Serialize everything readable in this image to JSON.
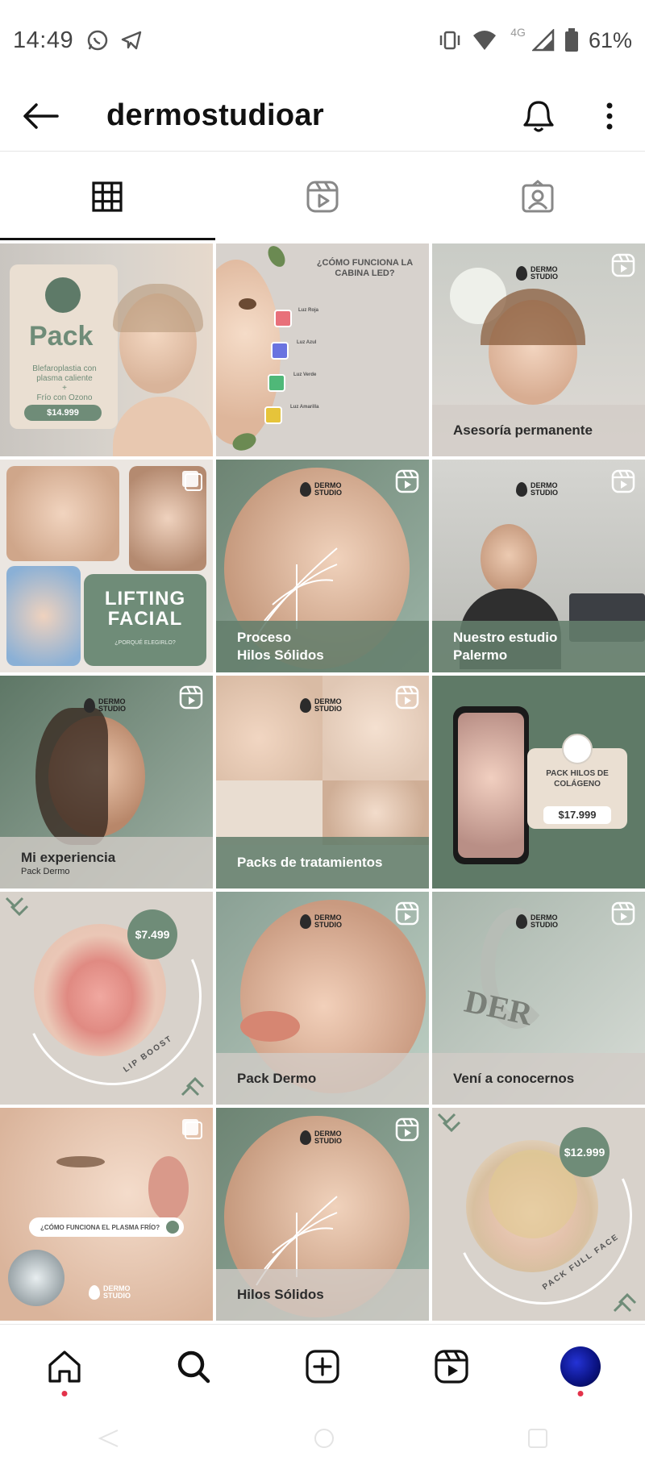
{
  "status_bar": {
    "time": "14:49",
    "battery": "61%",
    "network": "4G"
  },
  "header": {
    "username": "dermostudioar"
  },
  "tabs": [
    {
      "name": "posts-grid",
      "active": true
    },
    {
      "name": "reels",
      "active": false
    },
    {
      "name": "tagged",
      "active": false
    }
  ],
  "posts": [
    {
      "type": "image",
      "texts": {
        "title": "Pack",
        "desc1": "Blefaroplastia con",
        "desc2": "plasma caliente",
        "desc3": "+",
        "desc4": "Frío con Ozono",
        "price": "$14.999"
      }
    },
    {
      "type": "image",
      "texts": {
        "title1": "¿CÓMO FUNCIONA LA",
        "title2": "CABINA LED?",
        "l1": "Luz Roja",
        "l2": "Luz Azul",
        "l3": "Luz Verde",
        "l4": "Luz Amarilla"
      }
    },
    {
      "type": "reel",
      "caption": "Asesoría permanente"
    },
    {
      "type": "carousel",
      "texts": {
        "title1": "LIFTING",
        "title2": "FACIAL",
        "sub": "¿PORQUÉ ELEGIRLO?"
      }
    },
    {
      "type": "reel",
      "caption": "Proceso",
      "caption2": "Hilos Sólidos"
    },
    {
      "type": "reel",
      "caption": "Nuestro estudio",
      "caption2": "Palermo"
    },
    {
      "type": "reel",
      "caption": "Mi experiencia",
      "sub": "Pack Dermo"
    },
    {
      "type": "reel",
      "caption": "Packs de  tratamientos"
    },
    {
      "type": "image",
      "texts": {
        "title1": "PACK HILOS DE",
        "title2": "COLÁGENO",
        "price": "$17.999"
      }
    },
    {
      "type": "image",
      "texts": {
        "price": "$7.499",
        "label": "LIP BOOST"
      }
    },
    {
      "type": "reel",
      "caption": "Pack Dermo"
    },
    {
      "type": "reel",
      "caption": "Vení a conocernos"
    },
    {
      "type": "carousel",
      "texts": {
        "search": "¿CÓMO FUNCIONA EL PLASMA FRÍO?"
      }
    },
    {
      "type": "reel",
      "caption": "Hilos Sólidos"
    },
    {
      "type": "image",
      "texts": {
        "price": "$12.999",
        "label": "PACK FULL FACE"
      }
    }
  ],
  "brand": {
    "line1": "DERMO",
    "line2": "STUDIO"
  },
  "colors": {
    "accent_green": "#6f8c78",
    "beige": "#d4cec7",
    "notif_red": "#e3324a"
  },
  "nav": [
    "home-icon",
    "search-icon",
    "create-icon",
    "reels-icon",
    "profile-avatar"
  ]
}
